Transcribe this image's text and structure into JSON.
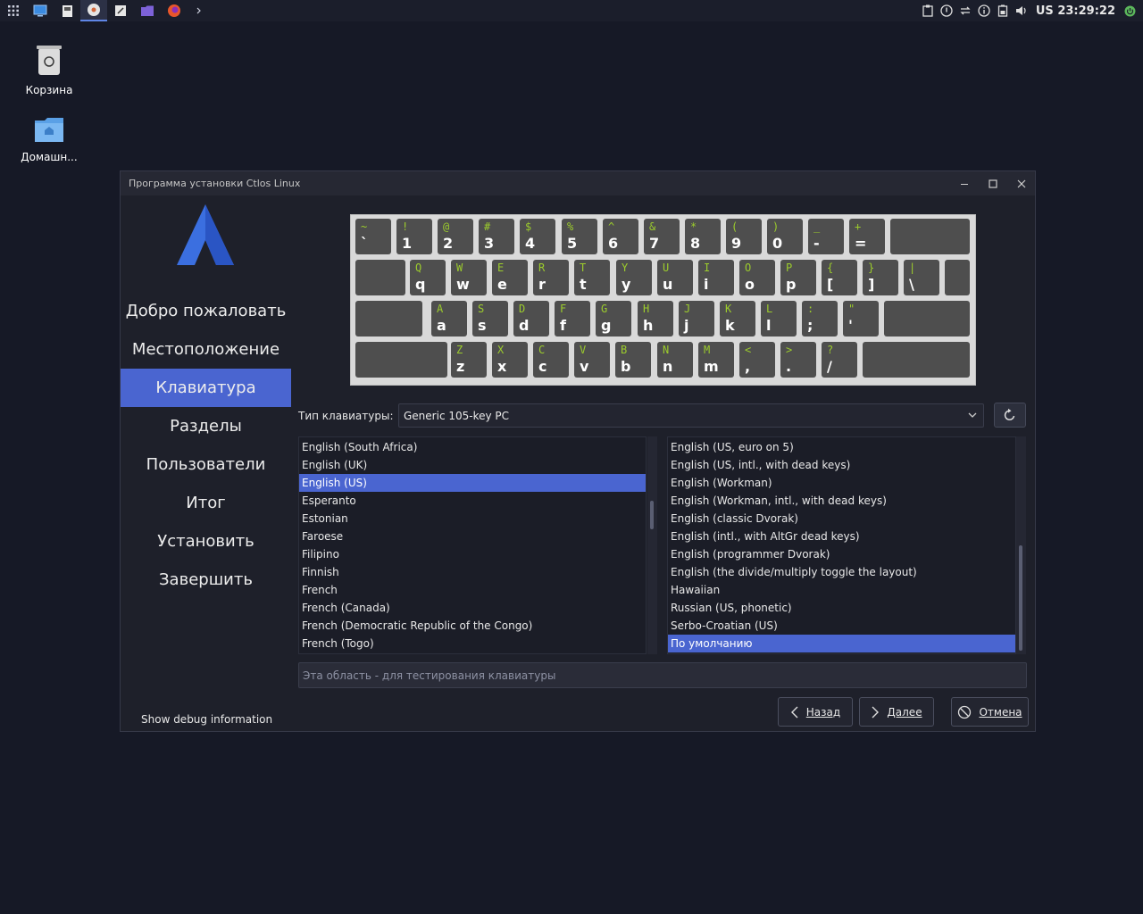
{
  "taskbar": {
    "icons": [
      "apps-grid-icon",
      "desktop-icon",
      "file-manager-icon",
      "installer-icon",
      "text-editor-icon",
      "folder-icon",
      "firefox-icon",
      "terminal-icon"
    ],
    "tray_icons": [
      "clipboard-icon",
      "update-icon",
      "network-icon",
      "info-icon",
      "battery-icon",
      "volume-icon"
    ],
    "layout_indicator": "US",
    "time": "23:29:22"
  },
  "desktop": {
    "trash_label": "Корзина",
    "home_label": "Домашн..."
  },
  "window": {
    "title": "Программа установки Ctlos Linux"
  },
  "sidebar": {
    "items": [
      {
        "label": "Добро пожаловать"
      },
      {
        "label": "Местоположение"
      },
      {
        "label": "Клавиатура"
      },
      {
        "label": "Разделы"
      },
      {
        "label": "Пользователи"
      },
      {
        "label": "Итог"
      },
      {
        "label": "Установить"
      },
      {
        "label": "Завершить"
      }
    ],
    "active_index": 2,
    "debug_label": "Show debug information"
  },
  "keyboard": {
    "rows": [
      [
        [
          "~",
          "`"
        ],
        [
          "!",
          "1"
        ],
        [
          "@",
          "2"
        ],
        [
          "#",
          "3"
        ],
        [
          "$",
          "4"
        ],
        [
          "%",
          "5"
        ],
        [
          "^",
          "6"
        ],
        [
          "&",
          "7"
        ],
        [
          "*",
          "8"
        ],
        [
          "(",
          "9"
        ],
        [
          ")",
          "0"
        ],
        [
          "_",
          "-"
        ],
        [
          "+",
          "="
        ]
      ],
      [
        [
          "Q",
          "q"
        ],
        [
          "W",
          "w"
        ],
        [
          "E",
          "e"
        ],
        [
          "R",
          "r"
        ],
        [
          "T",
          "t"
        ],
        [
          "Y",
          "y"
        ],
        [
          "U",
          "u"
        ],
        [
          "I",
          "i"
        ],
        [
          "O",
          "o"
        ],
        [
          "P",
          "p"
        ],
        [
          "{",
          "["
        ],
        [
          "}",
          "]"
        ],
        [
          "|",
          "\\"
        ]
      ],
      [
        [
          "A",
          "a"
        ],
        [
          "S",
          "s"
        ],
        [
          "D",
          "d"
        ],
        [
          "F",
          "f"
        ],
        [
          "G",
          "g"
        ],
        [
          "H",
          "h"
        ],
        [
          "J",
          "j"
        ],
        [
          "K",
          "k"
        ],
        [
          "L",
          "l"
        ],
        [
          ":",
          ";"
        ],
        [
          "\"",
          "'"
        ]
      ],
      [
        [
          "Z",
          "z"
        ],
        [
          "X",
          "x"
        ],
        [
          "C",
          "c"
        ],
        [
          "V",
          "v"
        ],
        [
          "B",
          "b"
        ],
        [
          "N",
          "n"
        ],
        [
          "M",
          "m"
        ],
        [
          "<",
          ","
        ],
        [
          ">",
          "."
        ],
        [
          "?",
          "/"
        ]
      ]
    ]
  },
  "model": {
    "label": "Тип клавиатуры:",
    "value": "Generic 105-key PC"
  },
  "layouts": [
    "English (South Africa)",
    "English (UK)",
    "English (US)",
    "Esperanto",
    "Estonian",
    "Faroese",
    "Filipino",
    "Finnish",
    "French",
    "French (Canada)",
    "French (Democratic Republic of the Congo)",
    "French (Togo)"
  ],
  "layouts_selected": 2,
  "variants": [
    "English (US, euro on 5)",
    "English (US, intl., with dead keys)",
    "English (Workman)",
    "English (Workman, intl., with dead keys)",
    "English (classic Dvorak)",
    "English (intl., with AltGr dead keys)",
    "English (programmer Dvorak)",
    "English (the divide/multiply toggle the layout)",
    "Hawaiian",
    "Russian (US, phonetic)",
    "Serbo-Croatian (US)",
    "По умолчанию"
  ],
  "variants_selected": 11,
  "test_field": {
    "placeholder": "Эта область - для тестирования клавиатуры"
  },
  "buttons": {
    "back": "Назад",
    "next": "Далее",
    "cancel": "Отмена"
  },
  "colors": {
    "accent": "#4a65d0",
    "key_shift_label": "#9ccc2c",
    "logo_blue": "#3b6fe0"
  }
}
